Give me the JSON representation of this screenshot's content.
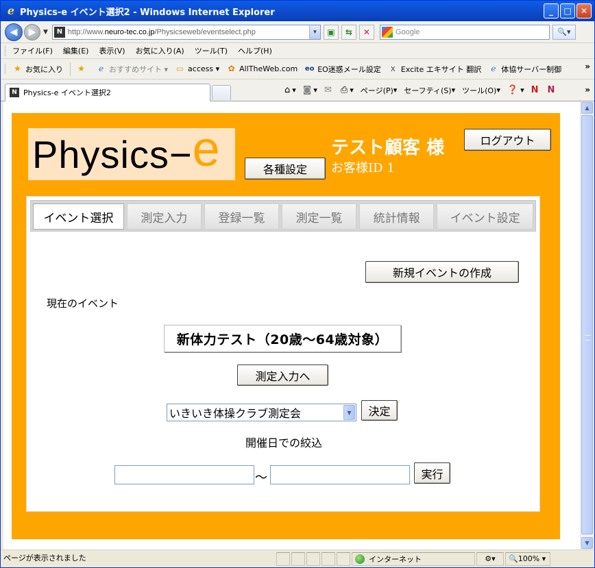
{
  "window": {
    "title": "Physics-e イベント選択2 - Windows Internet Explorer",
    "controls": [
      "_",
      "□",
      "✕"
    ]
  },
  "address_bar": {
    "url_prefix": "http://www.",
    "url_host": "neuro-tec.co.jp",
    "url_path": "/Physicseweb/eventselect.php",
    "search_placeholder": "Google"
  },
  "menu": [
    "ファイル(F)",
    "編集(E)",
    "表示(V)",
    "お気に入り(A)",
    "ツール(T)",
    "ヘルプ(H)"
  ],
  "favorites": {
    "label": "お気に入り",
    "items": [
      {
        "label": "おすすめサイト ▾",
        "icon": "ie-icon",
        "muted": true
      },
      {
        "label": "access ▾",
        "icon": "folder-icon",
        "muted": false
      },
      {
        "label": "AllTheWeb.com",
        "icon": "alltheweb-icon",
        "muted": false
      },
      {
        "label": "EO迷惑メール設定",
        "icon": "eo-icon",
        "muted": false
      },
      {
        "label": "Excite エキサイト  翻訳",
        "icon": "excite-icon",
        "muted": false
      },
      {
        "label": "体協サーバー制御",
        "icon": "ie-page-icon",
        "muted": false
      }
    ]
  },
  "browser_tab": {
    "label": "Physics-e イベント選択2"
  },
  "command_bar": {
    "page": "ページ(P)",
    "safety": "セーフティ(S)",
    "tools": "ツール(O)"
  },
  "status": {
    "text": "ページが表示されました",
    "zone": "インターネット",
    "zoom": "100%"
  },
  "page": {
    "logo_text": "Physics−",
    "logo_accent": "e",
    "settings_button": "各種設定",
    "customer_name": "テスト顧客 様",
    "customer_id": "お客様ID 1",
    "logout_button": "ログアウト",
    "tabs": [
      {
        "label": "イベント選択",
        "active": true
      },
      {
        "label": "測定入力",
        "active": false
      },
      {
        "label": "登録一覧",
        "active": false
      },
      {
        "label": "測定一覧",
        "active": false
      },
      {
        "label": "統計情報",
        "active": false
      },
      {
        "label": "イベント設定",
        "active": false
      }
    ],
    "new_event_button": "新規イベントの作成",
    "current_event_label": "現在のイベント",
    "current_event": "新体力テスト（20歳～64歳対象）",
    "to_measure_button": "測定入力へ",
    "event_select_value": "いきいき体操クラブ測定会",
    "decide_button": "決定",
    "date_filter_label": "開催日での絞込",
    "date_from": "",
    "date_to": "",
    "date_sep": "～",
    "run_button": "実行"
  }
}
